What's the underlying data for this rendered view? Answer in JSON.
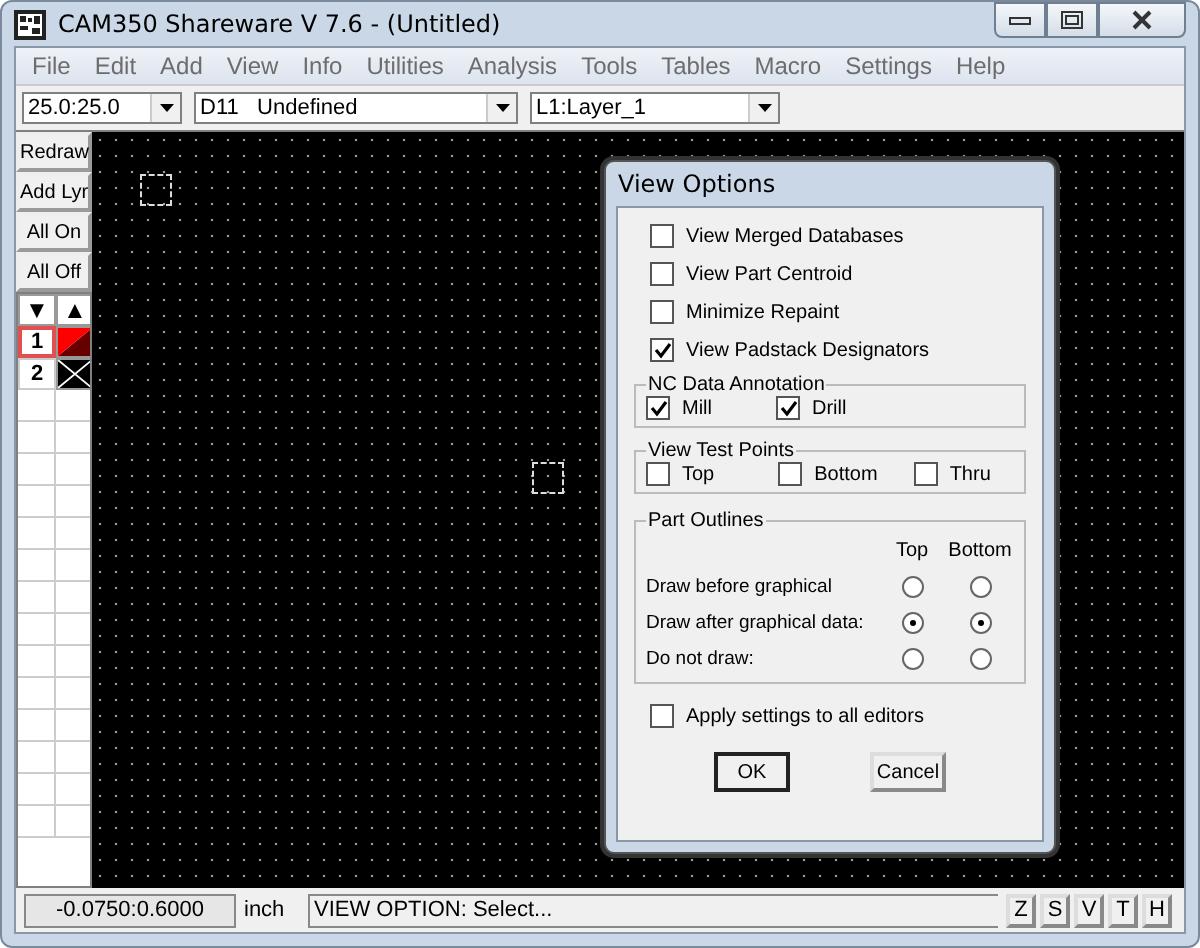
{
  "window": {
    "title": "CAM350 Shareware V 7.6 - (Untitled)"
  },
  "menu": [
    "File",
    "Edit",
    "Add",
    "View",
    "Info",
    "Utilities",
    "Analysis",
    "Tools",
    "Tables",
    "Macro",
    "Settings",
    "Help"
  ],
  "toolbar": {
    "grid": "25.0:25.0",
    "dcode": "D11   Undefined",
    "layer": "L1:Layer_1"
  },
  "side_buttons": [
    "Redraw",
    "Add Lyr",
    "All On",
    "All Off"
  ],
  "arrows": [
    "▼",
    "▲"
  ],
  "layers": [
    {
      "label": "1",
      "selected": true,
      "on": true,
      "color": "#ff0000"
    },
    {
      "label": "2",
      "selected": false,
      "on": false,
      "color": "#000000"
    }
  ],
  "dialog": {
    "title": "View Options",
    "options": [
      {
        "label": "View Merged Databases",
        "checked": false
      },
      {
        "label": "View Part Centroid",
        "checked": false
      },
      {
        "label": "Minimize Repaint",
        "checked": false
      },
      {
        "label": "View Padstack Designators",
        "checked": true
      }
    ],
    "groups": [
      {
        "title": "NC Data Annotation",
        "items": [
          {
            "label": "Mill",
            "checked": true
          },
          {
            "label": "Drill",
            "checked": true
          }
        ]
      },
      {
        "title": "View Test Points",
        "items": [
          {
            "label": "Top",
            "checked": false
          },
          {
            "label": "Bottom",
            "checked": false
          },
          {
            "label": "Thru",
            "checked": false
          }
        ]
      }
    ],
    "part_outlines": {
      "title": "Part Outlines",
      "columns": [
        "Top",
        "Bottom"
      ],
      "rows": [
        {
          "label": "Draw before graphical",
          "options": [
            {
              "selected": false
            },
            {
              "selected": false
            }
          ]
        },
        {
          "label": "Draw after graphical data:",
          "options": [
            {
              "selected": true
            },
            {
              "selected": true
            }
          ]
        },
        {
          "label": "Do not draw:",
          "options": [
            {
              "selected": false
            },
            {
              "selected": false
            }
          ]
        }
      ]
    },
    "apply": {
      "label": "Apply settings to all editors",
      "checked": false
    },
    "buttons": [
      "OK",
      "Cancel"
    ]
  },
  "status_bar": {
    "coords": "-0.0750:0.6000",
    "unit": "inch",
    "message": "VIEW OPTION: Select...",
    "keys": [
      "Z",
      "S",
      "V",
      "T",
      "H"
    ]
  }
}
